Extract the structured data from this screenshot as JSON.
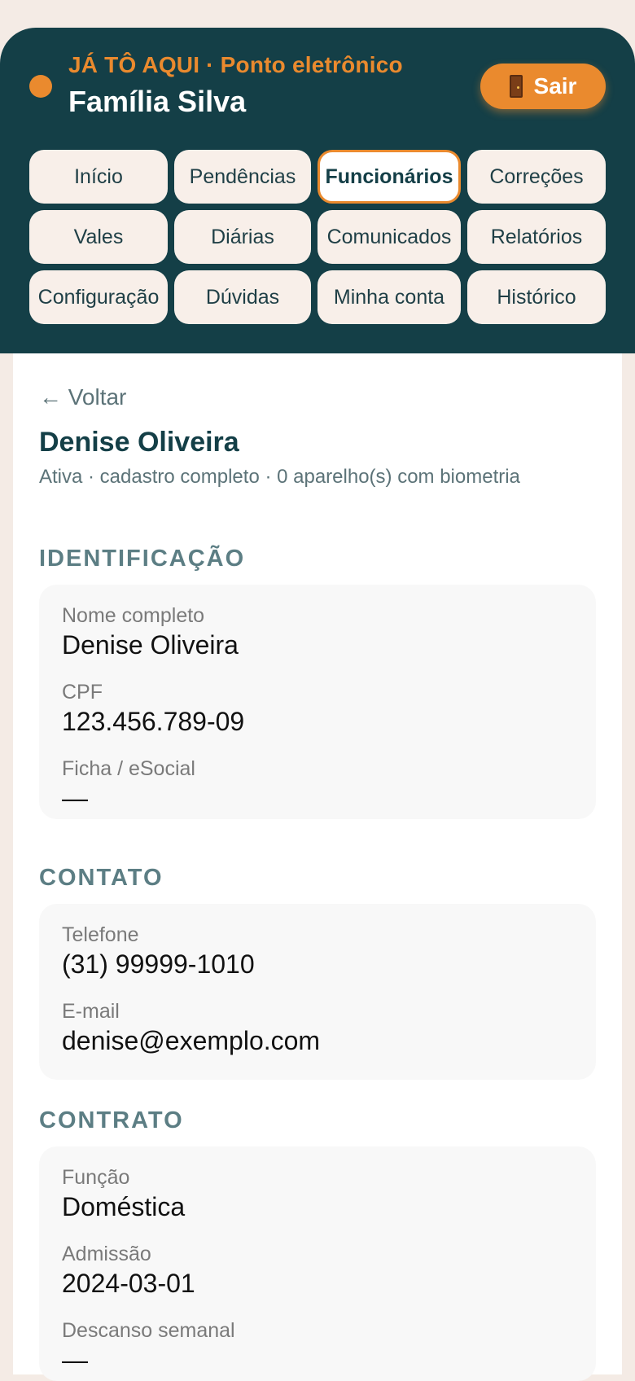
{
  "header": {
    "brand": "JÁ TÔ AQUI · Ponto eletrônico",
    "family": "Família Silva",
    "logout_label": "Sair",
    "logout_icon": "door-icon",
    "accent_color": "#ea8a2e",
    "header_color": "#143f47"
  },
  "nav": {
    "items": [
      {
        "label": "Início"
      },
      {
        "label": "Pendências"
      },
      {
        "label": "Funcionários",
        "active": true
      },
      {
        "label": "Correções"
      },
      {
        "label": "Vales"
      },
      {
        "label": "Diárias"
      },
      {
        "label": "Comunicados"
      },
      {
        "label": "Relatórios"
      },
      {
        "label": "Configuração"
      },
      {
        "label": "Dúvidas"
      },
      {
        "label": "Minha conta"
      },
      {
        "label": "Histórico"
      }
    ]
  },
  "page": {
    "back_label": "← Voltar",
    "employee_name": "Denise Oliveira",
    "employee_status": "Ativa · cadastro completo · 0 aparelho(s) com biometria"
  },
  "sections": {
    "identificacao": {
      "title": "IDENTIFICAÇÃO",
      "fields": [
        {
          "label": "Nome completo",
          "value": "Denise Oliveira"
        },
        {
          "label": "CPF",
          "value": "123.456.789-09"
        },
        {
          "label": "Ficha / eSocial",
          "value": "—"
        }
      ]
    },
    "contato": {
      "title": "CONTATO",
      "fields": [
        {
          "label": "Telefone",
          "value": "(31) 99999-1010"
        },
        {
          "label": "E-mail",
          "value": "denise@exemplo.com"
        }
      ]
    },
    "contrato": {
      "title": "CONTRATO",
      "fields": [
        {
          "label": "Função",
          "value": "Doméstica"
        },
        {
          "label": "Admissão",
          "value": "2024-03-01"
        },
        {
          "label": "Descanso semanal",
          "value": "—"
        }
      ]
    }
  }
}
